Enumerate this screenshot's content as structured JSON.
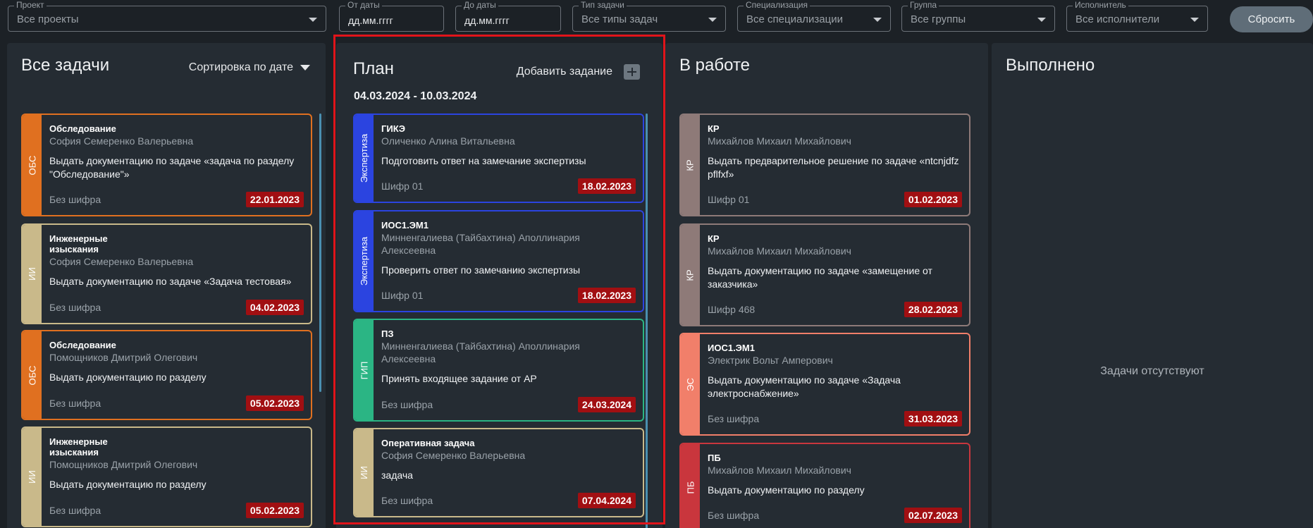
{
  "filters": {
    "project": {
      "label": "Проект",
      "value": "Все проекты"
    },
    "date_from": {
      "label": "От даты",
      "value": "дд.мм.гггг"
    },
    "date_to": {
      "label": "До даты",
      "value": "дд.мм.гггг"
    },
    "task_type": {
      "label": "Тип задачи",
      "value": "Все типы задач"
    },
    "specialization": {
      "label": "Специализация",
      "value": "Все специализации"
    },
    "group": {
      "label": "Группа",
      "value": "Все группы"
    },
    "executor": {
      "label": "Исполнитель",
      "value": "Все исполнители"
    },
    "reset_label": "Сбросить"
  },
  "columns": {
    "all": {
      "title": "Все задачи",
      "sort_label": "Сортировка по дате",
      "cards": [
        {
          "tag": "ОБС",
          "title": "Обследование",
          "person": "София Семеренко Валерьевна",
          "desc": "Выдать документацию по задаче «задача по разделу \"Обследование\"»",
          "cipher": "Без шифра",
          "date": "22.01.2023"
        },
        {
          "tag": "ИИ",
          "title": "Инженерные изыскания",
          "person": "София Семеренко Валерьевна",
          "desc": "Выдать документацию по задаче «Задача тестовая»",
          "cipher": "Без шифра",
          "date": "04.02.2023"
        },
        {
          "tag": "ОБС",
          "title": "Обследование",
          "person": "Помощников Дмитрий Олегович",
          "desc": "Выдать документацию по разделу",
          "cipher": "Без шифра",
          "date": "05.02.2023"
        },
        {
          "tag": "ИИ",
          "title": "Инженерные изыскания",
          "person": "Помощников Дмитрий Олегович",
          "desc": "Выдать документацию по разделу",
          "cipher": "Без шифра",
          "date": "05.02.2023"
        }
      ]
    },
    "plan": {
      "title": "План",
      "add_label": "Добавить задание",
      "date_range": "04.03.2024 - 10.03.2024",
      "cards": [
        {
          "tag": "Экспертиза",
          "title": "ГИКЭ",
          "person": "Оличенко Алина Витальевна",
          "desc": "Подготовить ответ на замечание экспертизы",
          "cipher": "Шифр 01",
          "date": "18.02.2023"
        },
        {
          "tag": "Экспертиза",
          "title": "ИОС1.ЭМ1",
          "person": "Минненгалиева (Тайбахтина) Аполлинария Алексеевна",
          "desc": "Проверить ответ по замечанию экспертизы",
          "cipher": "Шифр 01",
          "date": "18.02.2023"
        },
        {
          "tag": "ГИП",
          "title": "ПЗ",
          "person": "Минненгалиева (Тайбахтина) Аполлинария Алексеевна",
          "desc": "Принять входящее задание от АР",
          "cipher": "Без шифра",
          "date": "24.03.2024"
        },
        {
          "tag": "ИИ",
          "title": "Оперативная задача",
          "person": "София Семеренко Валерьевна",
          "desc": "задача",
          "cipher": "Без шифра",
          "date": "07.04.2024"
        }
      ]
    },
    "in_progress": {
      "title": "В работе",
      "cards": [
        {
          "tag": "КР",
          "title": "КР",
          "person": "Михайлов Михаил Михайлович",
          "desc": "Выдать предварительное решение по задаче «ntcnjdfz pflfxf»",
          "cipher": "Шифр 01",
          "date": "01.02.2023"
        },
        {
          "tag": "КР",
          "title": "КР",
          "person": "Михайлов Михаил Михайлович",
          "desc": "Выдать документацию по задаче «замещение от заказчика»",
          "cipher": "Шифр 468",
          "date": "28.02.2023"
        },
        {
          "tag": "ЭС",
          "title": "ИОС1.ЭМ1",
          "person": "Электрик Вольт Амперович",
          "desc": "Выдать документацию по задаче «Задача электроснабжение»",
          "cipher": "Без шифра",
          "date": "31.03.2023"
        },
        {
          "tag": "ПБ",
          "title": "ПБ",
          "person": "Михайлов Михаил Михайлович",
          "desc": "Выдать документацию по разделу",
          "cipher": "Без шифра",
          "date": "02.07.2023"
        }
      ]
    },
    "done": {
      "title": "Выполнено",
      "empty_message": "Задачи отсутствуют"
    }
  },
  "colors": {
    "obs": "#e07020",
    "ii": "#c9b98a",
    "expertise": "#2b44e0",
    "gip": "#2bb584",
    "kr": "#8e7a78",
    "es": "#f17f6a",
    "pb": "#c9363d",
    "date_badge": "#a10f12",
    "highlight": "#e0141a"
  }
}
